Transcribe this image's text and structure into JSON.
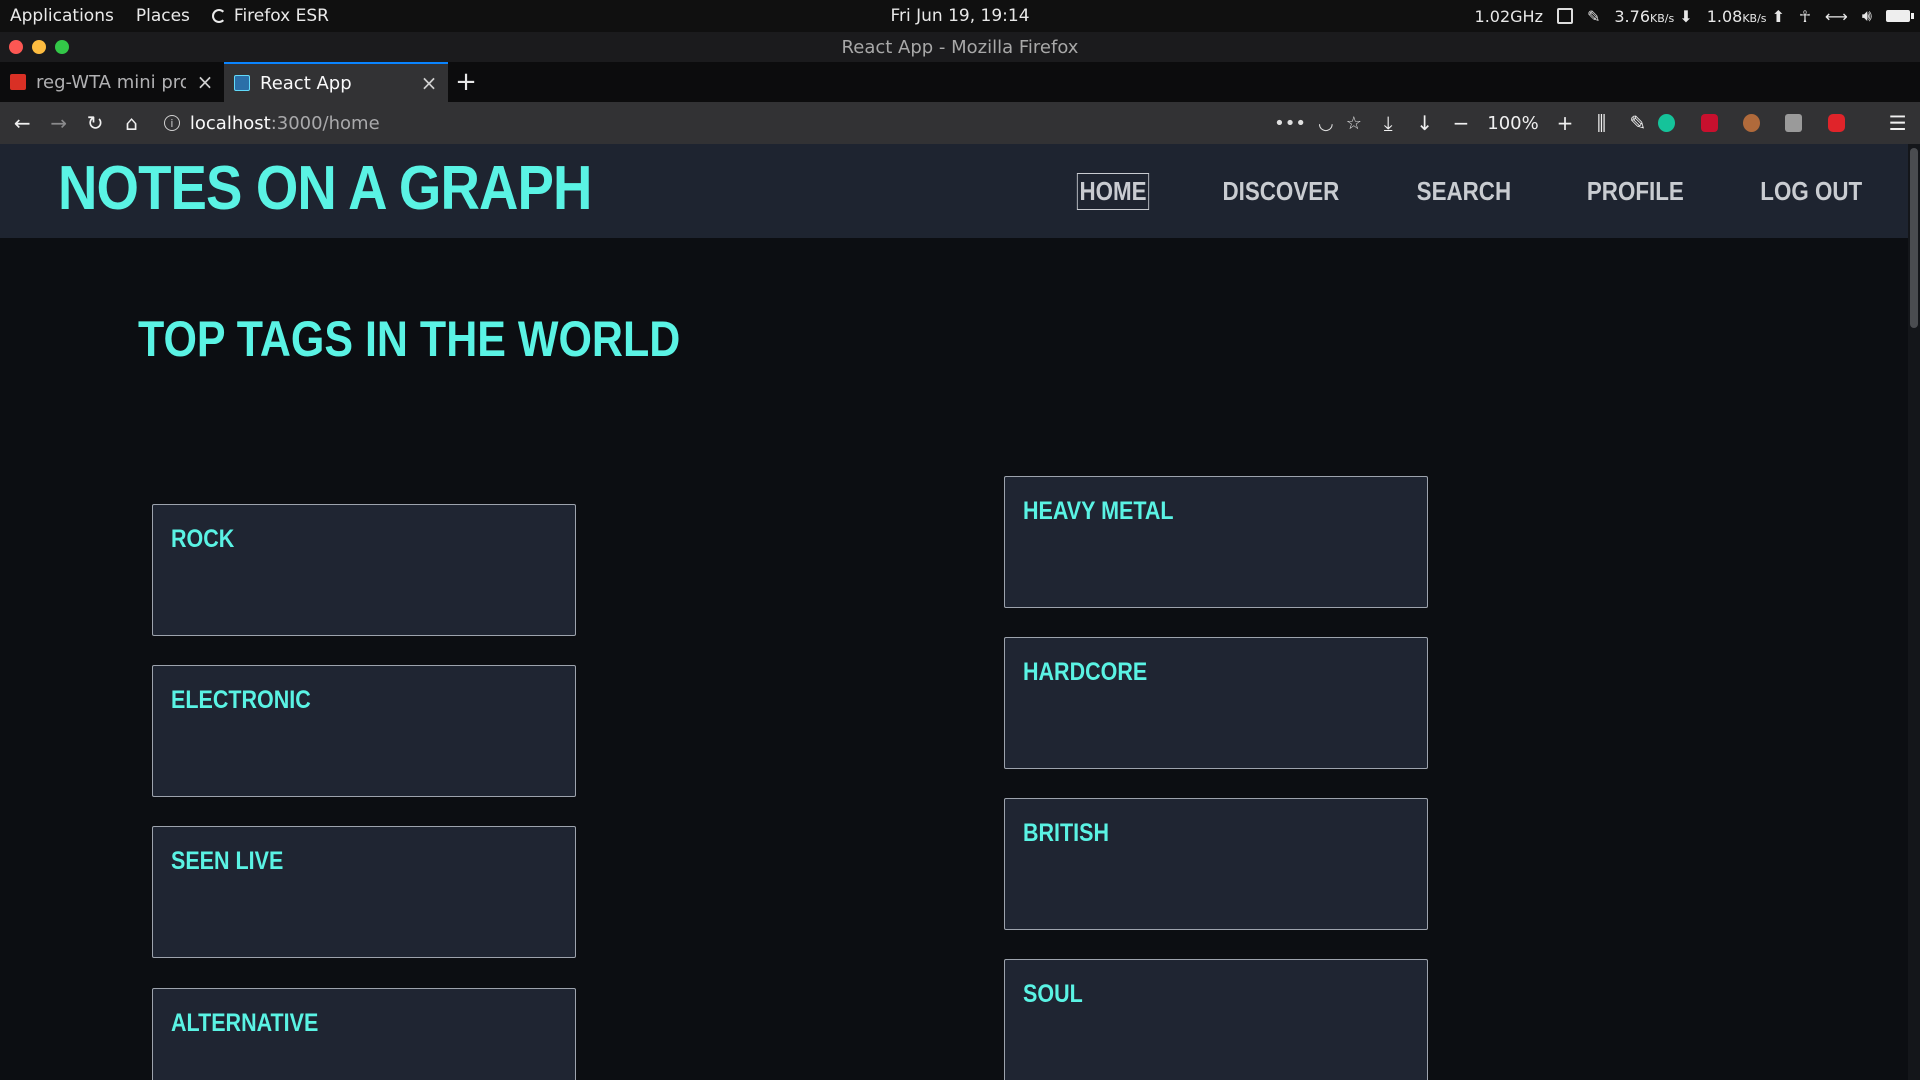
{
  "system_bar": {
    "applications": "Applications",
    "places": "Places",
    "browser": "Firefox ESR",
    "clock": "Fri Jun 19, 19:14",
    "cpu": "1.02GHz",
    "net_down": "3.76",
    "net_down_unit": "KB/s",
    "net_up": "1.08",
    "net_up_unit": "KB/s"
  },
  "window": {
    "title": "React App - Mozilla Firefox"
  },
  "tabs": [
    {
      "title": "reg-WTA mini proj",
      "favicon_color": "#d93025"
    },
    {
      "title": "React App",
      "favicon_color": "#61dafb"
    }
  ],
  "toolbar": {
    "url_host": "localhost",
    "url_path": ":3000/home",
    "zoom": "100%"
  },
  "site": {
    "logo": "NOTES ON A GRAPH",
    "nav": [
      "HOME",
      "DISCOVER",
      "SEARCH",
      "PROFILE",
      "LOG OUT"
    ],
    "active_nav": "HOME",
    "section_title": "TOP TAGS IN THE WORLD",
    "accent_color": "#5af3e4",
    "tags_left": [
      "ROCK",
      "ELECTRONIC",
      "SEEN LIVE",
      "ALTERNATIVE"
    ],
    "tags_right": [
      "HEAVY METAL",
      "HARDCORE",
      "BRITISH",
      "SOUL"
    ]
  }
}
